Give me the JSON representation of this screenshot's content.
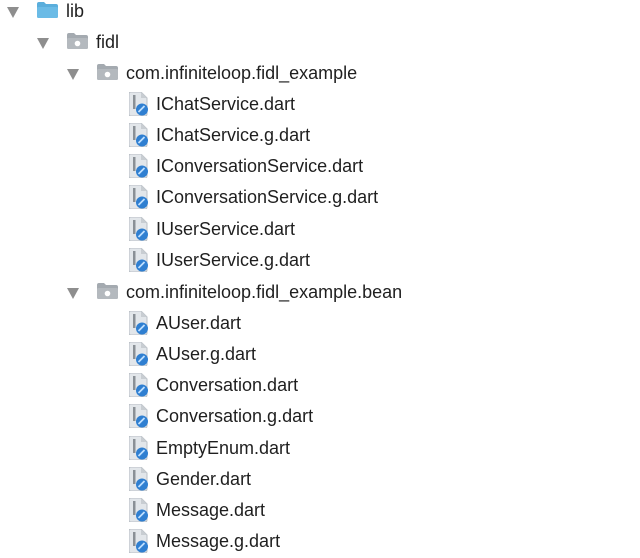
{
  "tree": {
    "lib": {
      "label": "lib",
      "icon": "blue-folder-icon"
    },
    "fidl": {
      "label": "fidl",
      "icon": "package-folder-icon"
    },
    "packages": [
      {
        "label": "com.infiniteloop.fidl_example",
        "icon": "package-folder-icon",
        "files": [
          "IChatService.dart",
          "IChatService.g.dart",
          "IConversationService.dart",
          "IConversationService.g.dart",
          "IUserService.dart",
          "IUserService.g.dart"
        ]
      },
      {
        "label": "com.infiniteloop.fidl_example.bean",
        "icon": "package-folder-icon",
        "files": [
          "AUser.dart",
          "AUser.g.dart",
          "Conversation.dart",
          "Conversation.g.dart",
          "EmptyEnum.dart",
          "Gender.dart",
          "Message.dart",
          "Message.g.dart"
        ]
      }
    ],
    "file_icon": "dart-file-icon"
  },
  "colors": {
    "lib_folder": "#5aaedc",
    "package_folder": "#a4aab0",
    "file_page": "#e2e6ea",
    "dart_badge": "#2f7fd1",
    "chevron": "#8e8e8e",
    "text": "#1f1f1f"
  }
}
